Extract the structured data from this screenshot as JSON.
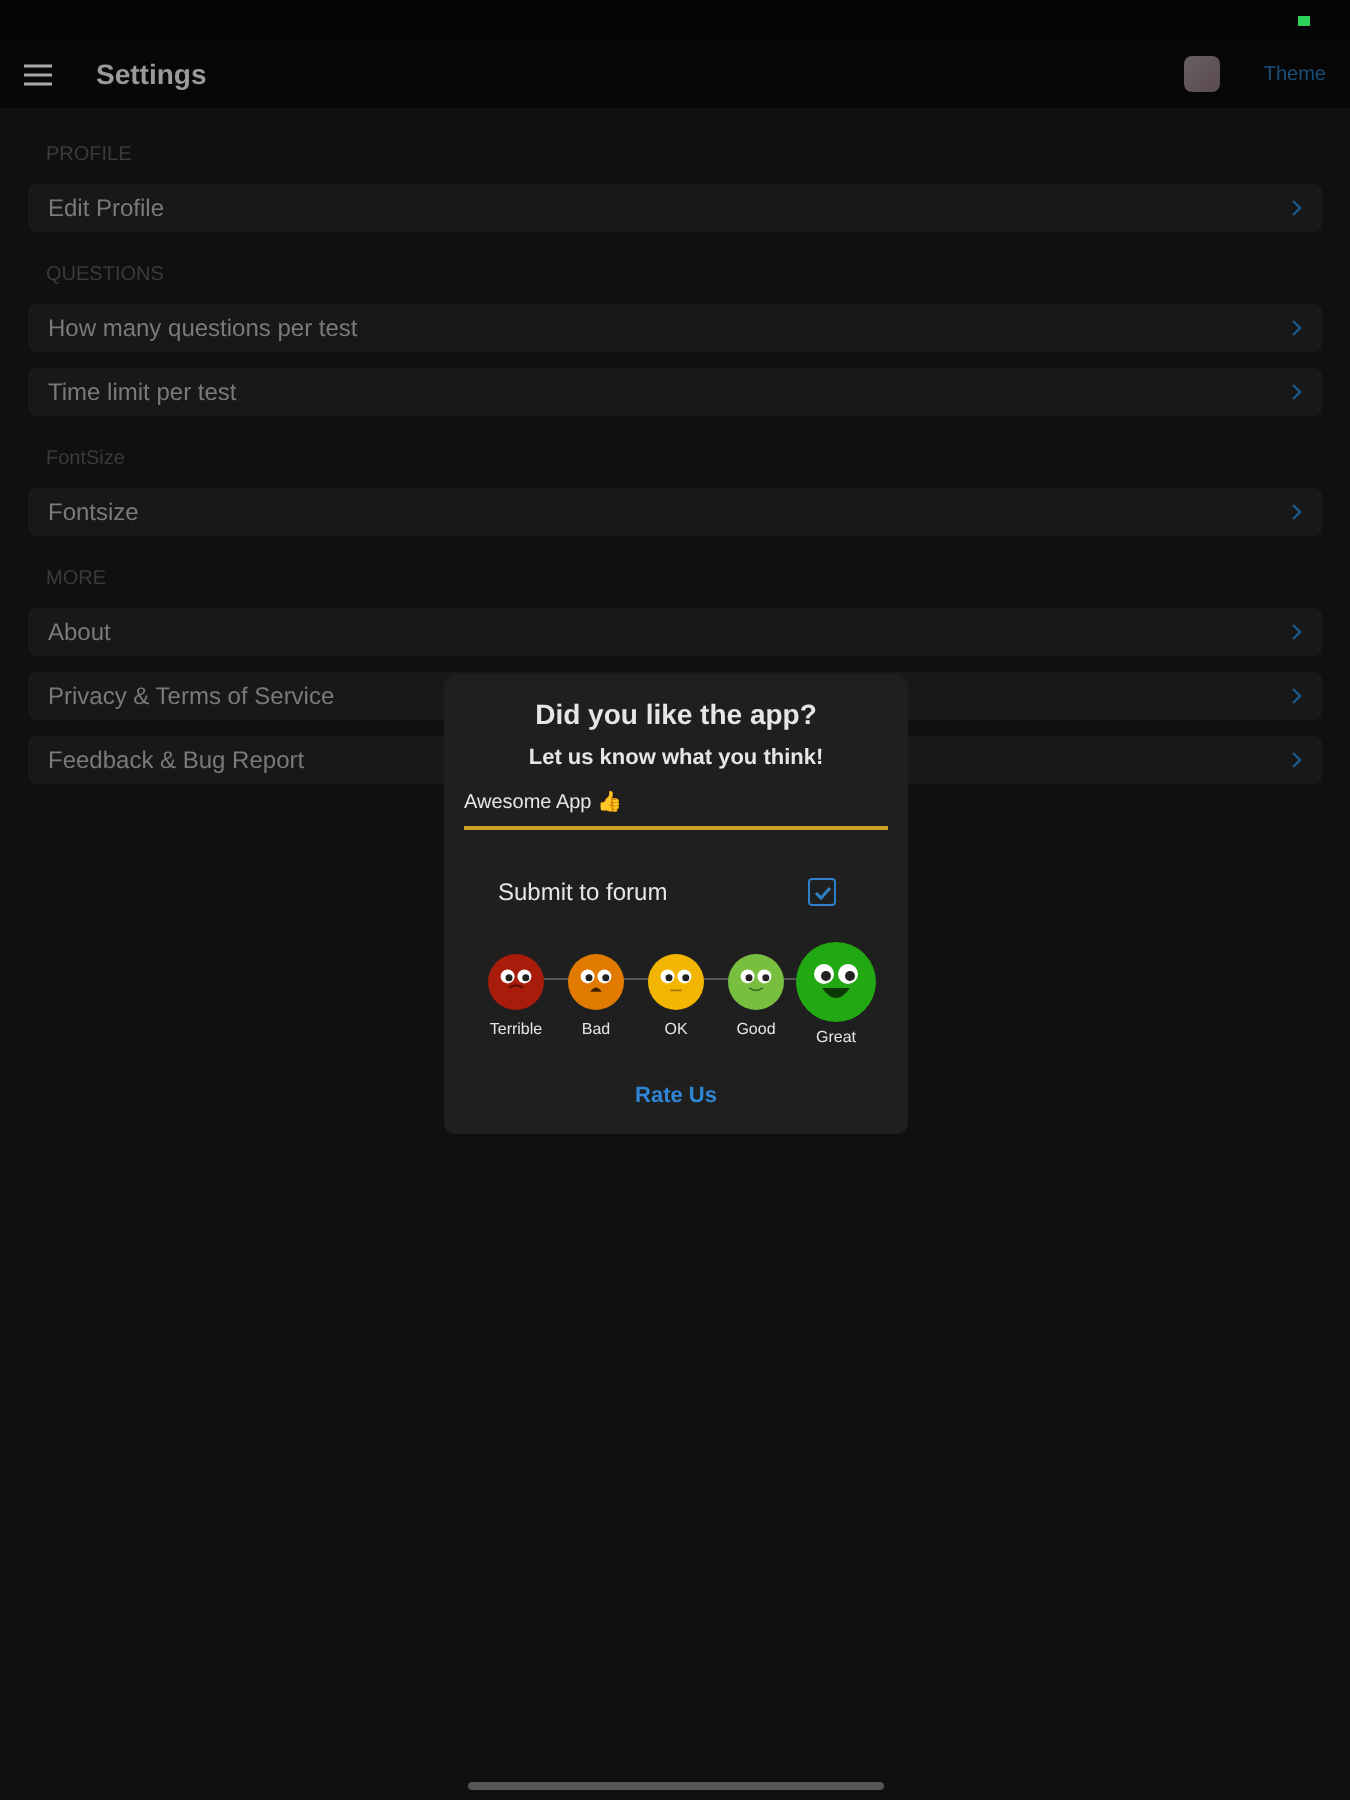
{
  "header": {
    "title": "Settings",
    "theme_label": "Theme"
  },
  "sections": [
    {
      "header": "PROFILE",
      "items": [
        {
          "label": "Edit Profile"
        }
      ]
    },
    {
      "header": "QUESTIONS",
      "items": [
        {
          "label": "How many questions per test"
        },
        {
          "label": "Time limit per test"
        }
      ]
    },
    {
      "header": "FontSize",
      "items": [
        {
          "label": "Fontsize"
        }
      ]
    },
    {
      "header": "MORE",
      "items": [
        {
          "label": "About"
        },
        {
          "label": "Privacy & Terms of Service"
        },
        {
          "label": "Feedback & Bug Report"
        }
      ]
    }
  ],
  "dialog": {
    "title": "Did you like the app?",
    "subtitle": "Let us know what you think!",
    "input_value": "Awesome App 👍",
    "checkbox": {
      "label": "Submit to forum",
      "checked": true
    },
    "ratings": [
      {
        "kind": "terrible",
        "label": "Terrible",
        "color": "#a81c0c",
        "selected": false
      },
      {
        "kind": "bad",
        "label": "Bad",
        "color": "#e07b00",
        "selected": false
      },
      {
        "kind": "ok",
        "label": "OK",
        "color": "#f2b600",
        "selected": false
      },
      {
        "kind": "good",
        "label": "Good",
        "color": "#78bf40",
        "selected": false
      },
      {
        "kind": "great",
        "label": "Great",
        "color": "#22a812",
        "selected": true
      }
    ],
    "button": "Rate Us"
  }
}
